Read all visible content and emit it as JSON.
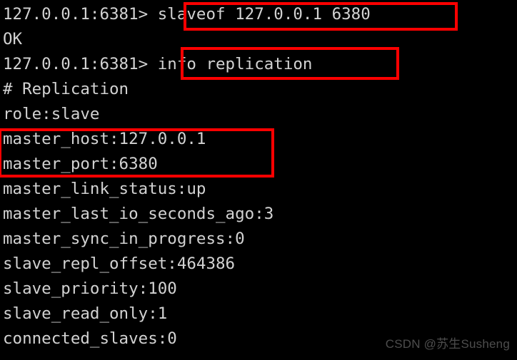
{
  "terminal": {
    "background_color": "#000000",
    "text_color": "#d2d2d2",
    "prompt": "127.0.0.1:6381>",
    "lines": [
      {
        "text": "127.0.0.1:6381> slaveof 127.0.0.1 6380"
      },
      {
        "text": "OK"
      },
      {
        "text": "127.0.0.1:6381> info replication"
      },
      {
        "text": "# Replication"
      },
      {
        "text": "role:slave"
      },
      {
        "text": "master_host:127.0.0.1"
      },
      {
        "text": "master_port:6380"
      },
      {
        "text": "master_link_status:up"
      },
      {
        "text": "master_last_io_seconds_ago:3"
      },
      {
        "text": "master_sync_in_progress:0"
      },
      {
        "text": "slave_repl_offset:464386"
      },
      {
        "text": "slave_priority:100"
      },
      {
        "text": "slave_read_only:1"
      },
      {
        "text": "connected_slaves:0"
      }
    ],
    "commands": {
      "slaveof": "slaveof 127.0.0.1 6380",
      "info_replication": "info replication"
    },
    "replication_info": {
      "section": "# Replication",
      "role": "role:slave",
      "master_host": "master_host:127.0.0.1",
      "master_port": "master_port:6380",
      "master_link_status": "master_link_status:up",
      "master_last_io_seconds_ago": "master_last_io_seconds_ago:3",
      "master_sync_in_progress": "master_sync_in_progress:0",
      "slave_repl_offset": "slave_repl_offset:464386",
      "slave_priority": "slave_priority:100",
      "slave_read_only": "slave_read_only:1",
      "connected_slaves": "connected_slaves:0"
    }
  },
  "annotations": {
    "highlight_color": "#ff0000",
    "boxes": [
      {
        "id": "slaveof-command",
        "label": "slaveof 127.0.0.1 6380"
      },
      {
        "id": "info-replication-command",
        "label": "info replication"
      },
      {
        "id": "master-host-port",
        "label": "master_host / master_port"
      }
    ]
  },
  "watermark": {
    "text": "CSDN @苏生Susheng",
    "color": "#4d4d4d"
  }
}
